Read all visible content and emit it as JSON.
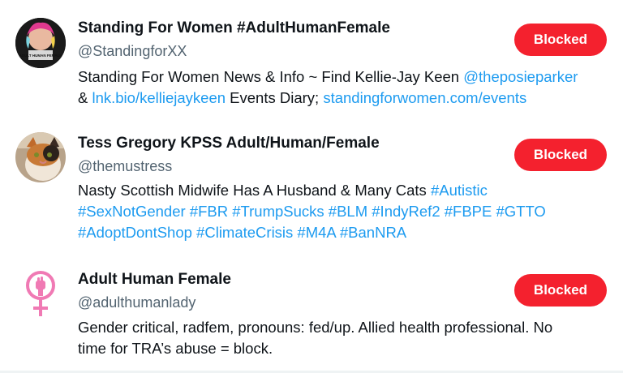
{
  "accounts": [
    {
      "name": "Standing For Women #AdultHumanFemale",
      "handle": "@StandingforXX",
      "button": "Blocked",
      "bio_line1": [
        {
          "t": "Standing For Women News & Info ~ Find Kellie-Jay Keen ",
          "link": false
        },
        {
          "t": "@theposieparker",
          "link": true
        }
      ],
      "bio_line2": [
        {
          "t": "& ",
          "link": false
        },
        {
          "t": "lnk.bio/kelliejaykeen",
          "link": true
        },
        {
          "t": " Events Diary; ",
          "link": false
        },
        {
          "t": "standingforwomen.com/events",
          "link": true
        }
      ],
      "avatar_text": "ADULT HUMAN FEMALE"
    },
    {
      "name": "Tess Gregory KPSS Adult/Human/Female",
      "handle": "@themustress",
      "button": "Blocked",
      "bio_line1": [
        {
          "t": "Nasty Scottish Midwife Has A Husband & Many Cats ",
          "link": false
        },
        {
          "t": "#Autistic",
          "link": true
        }
      ],
      "bio_line2": [
        {
          "t": "#SexNotGender #FBR #TrumpSucks #BLM #IndyRef2 #FBPE #GTTO",
          "link": true
        }
      ],
      "bio_line3": [
        {
          "t": "#AdoptDontShop #ClimateCrisis #M4A #BanNRA",
          "link": true
        }
      ]
    },
    {
      "name": "Adult Human Female",
      "handle": "@adulthumanlady",
      "button": "Blocked",
      "bio_line1": [
        {
          "t": "Gender critical, radfem, pronouns: fed/up. Allied health professional. No",
          "link": false
        }
      ],
      "bio_line2": [
        {
          "t": "time for TRA’s abuse = block.",
          "link": false
        }
      ]
    }
  ],
  "colors": {
    "accent_link": "#1d9bf0",
    "blocked_button": "#f4212e",
    "handle_gray": "#536471"
  },
  "icons": [
    "feminist-venus-fist-icon"
  ]
}
